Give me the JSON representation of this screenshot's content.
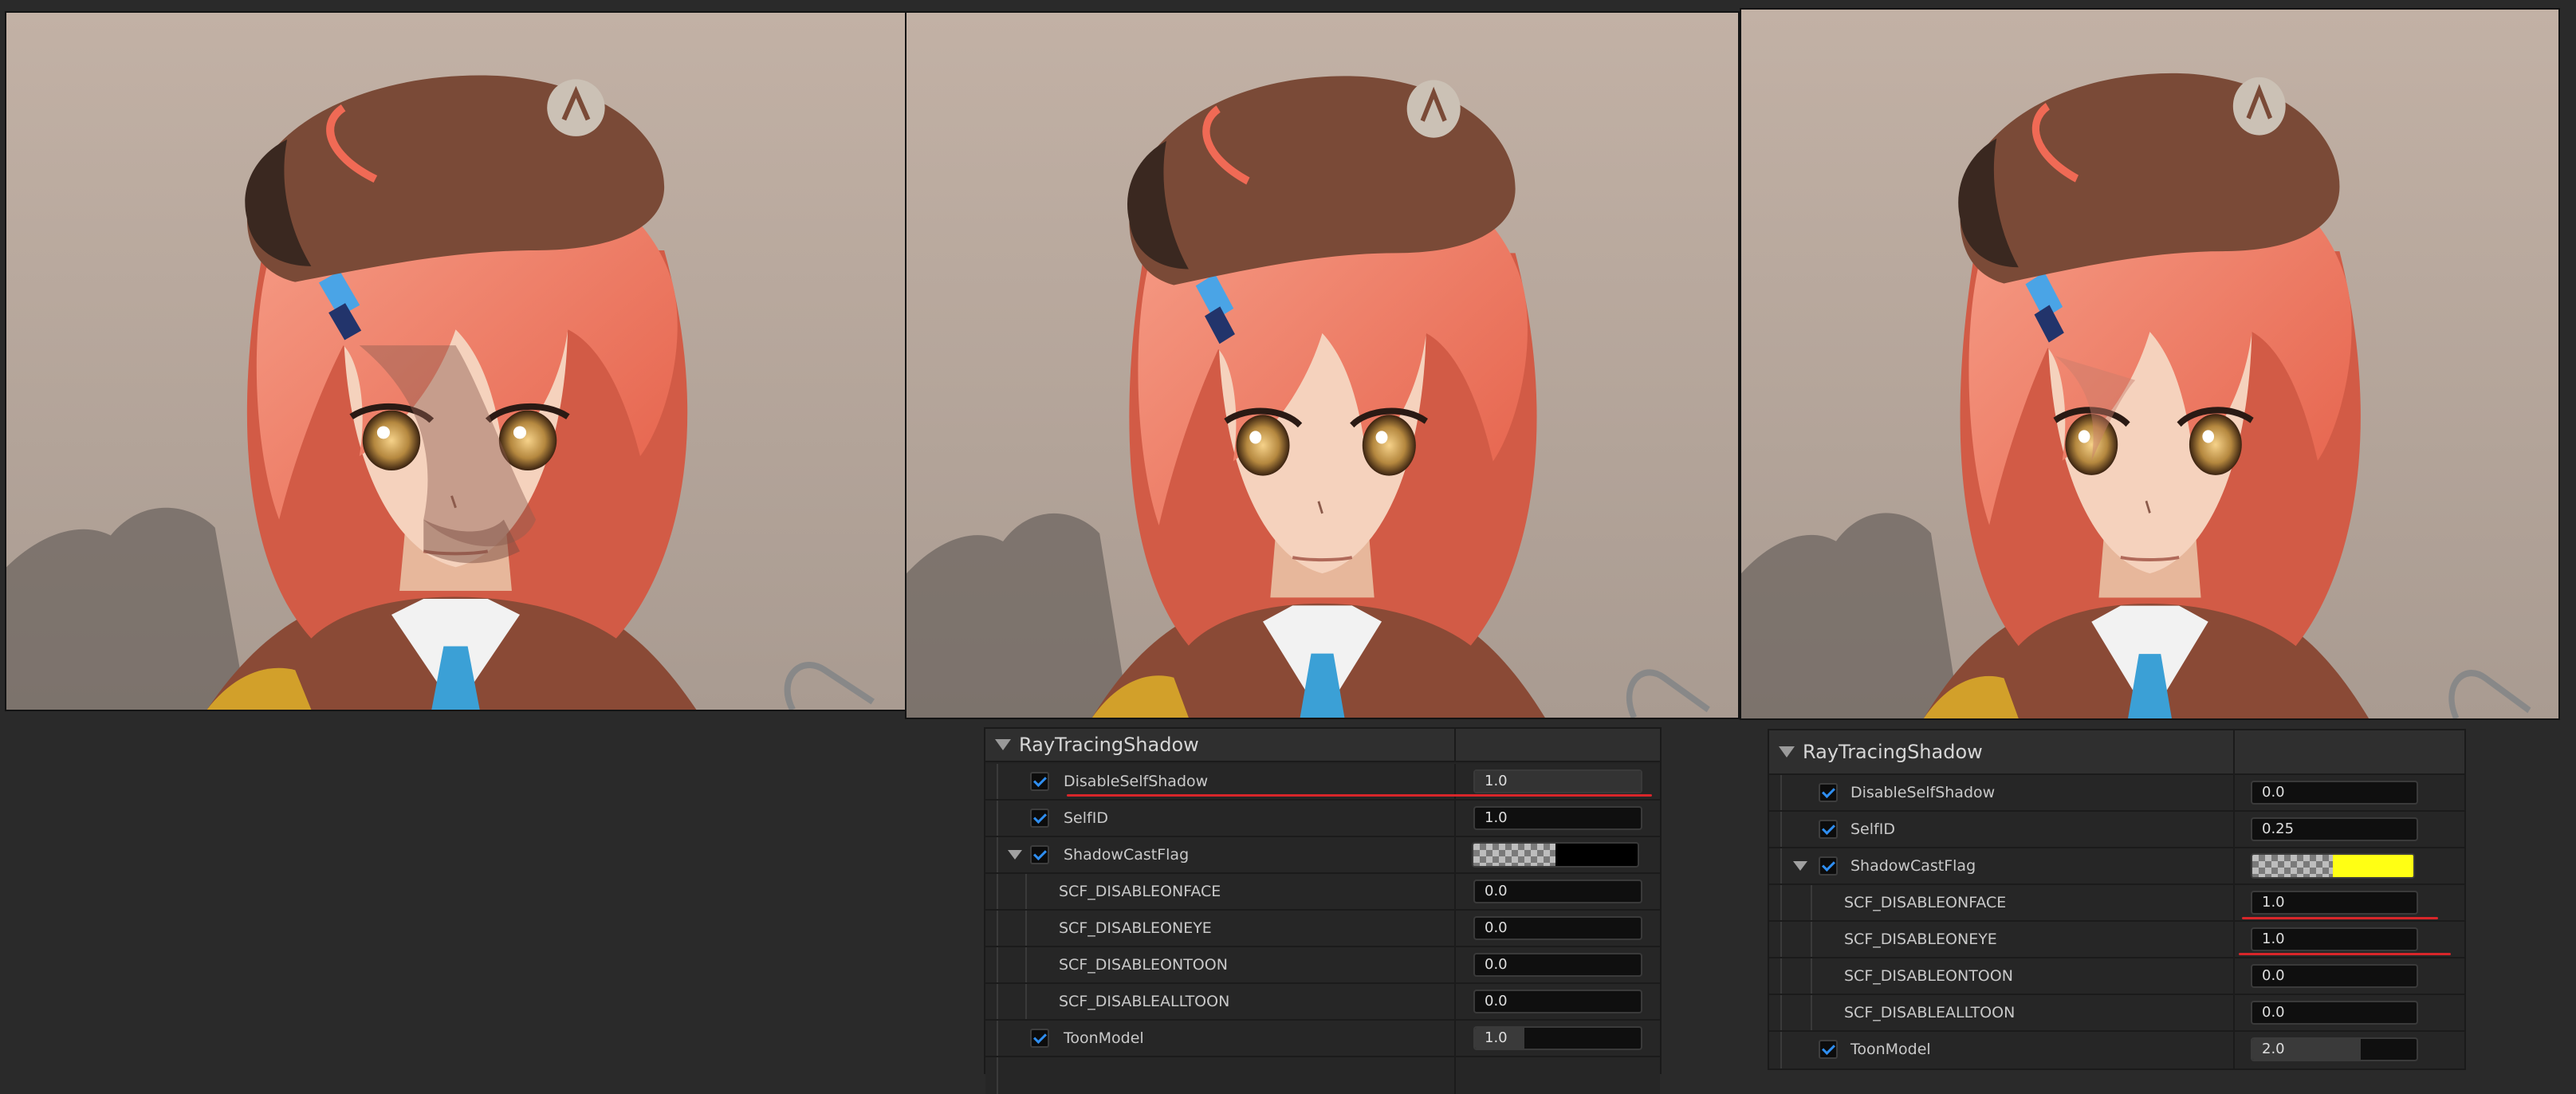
{
  "renders": [
    {
      "variant": "baseline",
      "shadow": "face-self-shadow"
    },
    {
      "variant": "disable-self-shadow",
      "shadow": "none"
    },
    {
      "variant": "scf-disable-face-eye",
      "shadow": "hair-only"
    }
  ],
  "panel_left": {
    "title": "RayTracingShadow",
    "rows": [
      {
        "label": "DisableSelfShadow",
        "value": "1.0",
        "checked": true
      },
      {
        "label": "SelfID",
        "value": "1.0",
        "checked": true
      },
      {
        "label": "ShadowCastFlag",
        "checked": true,
        "swatch": "#000000"
      },
      {
        "label": "SCF_DISABLEONFACE",
        "value": "0.0"
      },
      {
        "label": "SCF_DISABLEONEYE",
        "value": "0.0"
      },
      {
        "label": "SCF_DISABLEONTOON",
        "value": "0.0"
      },
      {
        "label": "SCF_DISABLEALLTOON",
        "value": "0.0"
      },
      {
        "label": "ToonModel",
        "value": "1.0",
        "checked": true
      }
    ]
  },
  "panel_right": {
    "title": "RayTracingShadow",
    "rows": [
      {
        "label": "DisableSelfShadow",
        "value": "0.0",
        "checked": true
      },
      {
        "label": "SelfID",
        "value": "0.25",
        "checked": true
      },
      {
        "label": "ShadowCastFlag",
        "checked": true,
        "swatch": "#ffff14"
      },
      {
        "label": "SCF_DISABLEONFACE",
        "value": "1.0"
      },
      {
        "label": "SCF_DISABLEONEYE",
        "value": "1.0"
      },
      {
        "label": "SCF_DISABLEONTOON",
        "value": "0.0"
      },
      {
        "label": "SCF_DISABLEALLTOON",
        "value": "0.0"
      },
      {
        "label": "ToonModel",
        "value": "2.0",
        "checked": true
      }
    ]
  },
  "colors": {
    "highlight": "#d8262a",
    "checkmark": "#2f8ef0"
  }
}
